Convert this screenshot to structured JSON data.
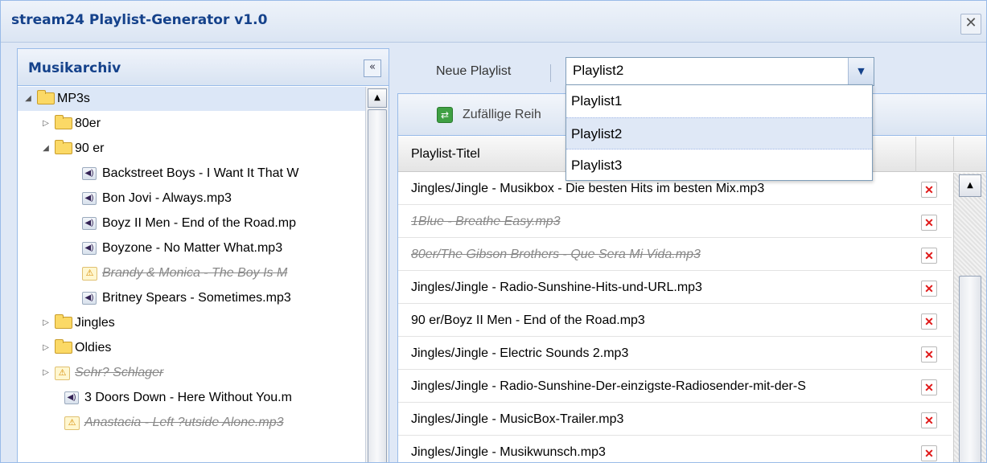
{
  "window": {
    "title": "stream24 Playlist-Generator v1.0",
    "close_glyph": "✕"
  },
  "archive": {
    "title": "Musikarchiv",
    "collapse_glyph": "«",
    "items": [
      {
        "label": "MP3s",
        "type": "folder",
        "expanded": true,
        "selected": true
      },
      {
        "label": "80er",
        "type": "folder",
        "expanded": false
      },
      {
        "label": "90 er",
        "type": "folder",
        "expanded": true
      },
      {
        "label": "Backstreet Boys - I Want It That W",
        "type": "audio"
      },
      {
        "label": "Bon Jovi - Always.mp3",
        "type": "audio"
      },
      {
        "label": "Boyz II Men - End of the Road.mp",
        "type": "audio"
      },
      {
        "label": "Boyzone - No Matter What.mp3",
        "type": "audio"
      },
      {
        "label": "Brandy & Monica - The Boy Is M",
        "type": "missing"
      },
      {
        "label": "Britney Spears - Sometimes.mp3",
        "type": "audio"
      },
      {
        "label": "Jingles",
        "type": "folder",
        "expanded": false
      },
      {
        "label": "Oldies",
        "type": "folder",
        "expanded": false
      },
      {
        "label": "Sehr? Schlager",
        "type": "missing-folder"
      },
      {
        "label": "3 Doors Down - Here Without You.m",
        "type": "audio"
      },
      {
        "label": "Anastacia - Left ?utside Alone.mp3",
        "type": "missing"
      }
    ]
  },
  "playlist": {
    "label": "Neue Playlist",
    "combo_value": "Playlist2",
    "options": [
      "Playlist1",
      "Playlist2",
      "Playlist3"
    ],
    "selected_option": "Playlist2",
    "shuffle_label": "Zufällige Reih",
    "column_title": "Playlist-Titel",
    "rows": [
      {
        "title": "Jingles/Jingle - Musikbox - Die besten Hits im besten Mix.mp3",
        "missing": false
      },
      {
        "title": "1Blue - Breathe Easy.mp3",
        "missing": true
      },
      {
        "title": "80er/The Gibson Brothers - Que Sera Mi Vida.mp3",
        "missing": true
      },
      {
        "title": "Jingles/Jingle - Radio-Sunshine-Hits-und-URL.mp3",
        "missing": false
      },
      {
        "title": "90 er/Boyz II Men - End of the Road.mp3",
        "missing": false
      },
      {
        "title": "Jingles/Jingle - Electric Sounds 2.mp3",
        "missing": false
      },
      {
        "title": "Jingles/Jingle - Radio-Sunshine-Der-einzigste-Radiosender-mit-der-S",
        "missing": false
      },
      {
        "title": "Jingles/Jingle - MusicBox-Trailer.mp3",
        "missing": false
      },
      {
        "title": "Jingles/Jingle - Musikwunsch.mp3",
        "missing": false
      }
    ]
  },
  "icons": {
    "audio": "speaker-icon",
    "folder": "folder-icon",
    "missing": "warning-icon",
    "delete": "delete-icon",
    "shuffle": "shuffle-icon"
  },
  "colors": {
    "title_blue": "#15428b",
    "panel_bg": "#dfe8f6",
    "delete_red": "#e01818",
    "selection": "#dce7f7"
  }
}
